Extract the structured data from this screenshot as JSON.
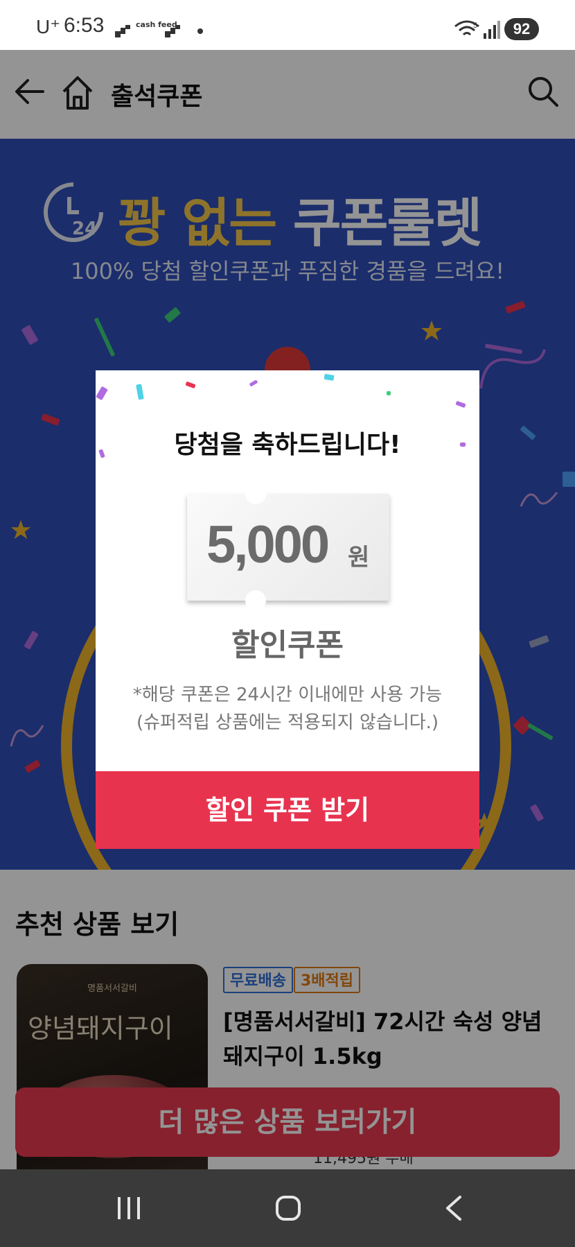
{
  "status_bar": {
    "carrier": "U⁺",
    "time": "6:53",
    "app_label": "cash feed",
    "battery": "92",
    "network": "5"
  },
  "header": {
    "title": "출석쿠폰"
  },
  "banner": {
    "clock_label": "24",
    "title_gold": "꽝 없는",
    "title_white": "쿠폰룰렛",
    "subtitle": "100% 당첨 할인쿠폰과 푸짐한 경품을 드려요!"
  },
  "modal": {
    "heading": "당첨을 축하드립니다!",
    "amount": "5,000",
    "unit": "원",
    "coupon_label": "할인쿠폰",
    "note_line1": "*해당 쿠폰은 24시간 이내에만 사용 가능",
    "note_line2": "(슈퍼적립 상품에는 적용되지 않습니다.)",
    "cta": "할인 쿠폰 받기"
  },
  "recommended": {
    "title": "추천 상품 보기",
    "product": {
      "image_brand": "명품서서갈비",
      "image_script": "양념돼지구이",
      "badge_free_shipping": "무료배송",
      "badge_points": "3배적립",
      "name": "[명품서서갈비] 72시간 숙성 양념돼지구이 1.5kg",
      "price": "11,495원 무배"
    },
    "more_button": "더 많은 상품 보러가기"
  },
  "colors": {
    "banner_blue": "#2f4fb8",
    "accent_red": "#e8334f",
    "gold": "#f5c84a"
  }
}
